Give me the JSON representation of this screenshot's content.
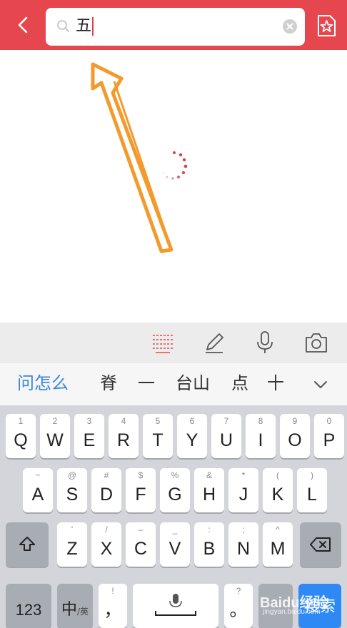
{
  "header": {
    "search_value": "五",
    "accent_color": "#e6474f"
  },
  "toolbar": {
    "icons": [
      "keyboard-lines-icon",
      "pencil-icon",
      "microphone-icon",
      "camera-icon"
    ]
  },
  "candidates": {
    "items": [
      "问怎么",
      "脊",
      "一",
      "台山",
      "点",
      "十"
    ]
  },
  "keyboard": {
    "row1": [
      {
        "hint": "1",
        "label": "Q"
      },
      {
        "hint": "2",
        "label": "W"
      },
      {
        "hint": "3",
        "label": "E"
      },
      {
        "hint": "4",
        "label": "R"
      },
      {
        "hint": "5",
        "label": "T"
      },
      {
        "hint": "6",
        "label": "Y"
      },
      {
        "hint": "7",
        "label": "U"
      },
      {
        "hint": "8",
        "label": "I"
      },
      {
        "hint": "9",
        "label": "O"
      },
      {
        "hint": "0",
        "label": "P"
      }
    ],
    "row2": [
      {
        "hint": "~",
        "label": "A"
      },
      {
        "hint": "@",
        "label": "S"
      },
      {
        "hint": "#",
        "label": "D"
      },
      {
        "hint": "$",
        "label": "F"
      },
      {
        "hint": "%",
        "label": "G"
      },
      {
        "hint": "&",
        "label": "H"
      },
      {
        "hint": "*",
        "label": "J"
      },
      {
        "hint": "(",
        "label": "K"
      },
      {
        "hint": ")",
        "label": "L"
      }
    ],
    "row3": [
      {
        "hint": "'",
        "label": "Z"
      },
      {
        "hint": "/",
        "label": "X"
      },
      {
        "hint": "–",
        "label": "C"
      },
      {
        "hint": "_",
        "label": "V"
      },
      {
        "hint": ":",
        "label": "B"
      },
      {
        "hint": ";",
        "label": "N"
      },
      {
        "hint": "^",
        "label": "M"
      }
    ],
    "num_label": "123",
    "lang_label": "中",
    "lang_sub": "/英",
    "comma_label": "，",
    "comma_hint": "!",
    "period_label": "。",
    "period_hint": "?",
    "search_label": "搜索"
  },
  "watermark": {
    "text": "Baidu经验",
    "sub": "jingyan.baidu.com"
  }
}
